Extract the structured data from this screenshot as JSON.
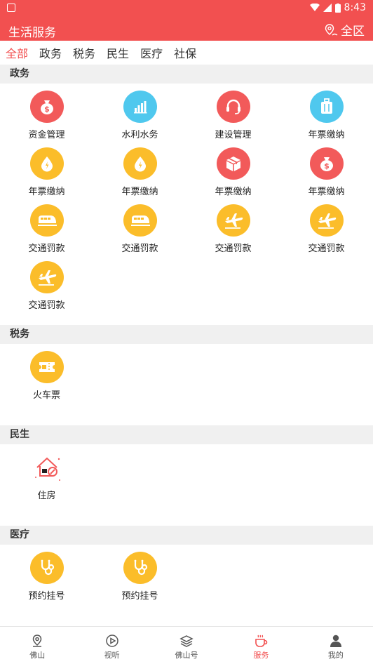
{
  "status": {
    "time": "8:43"
  },
  "header": {
    "title": "生活服务",
    "location": "全区"
  },
  "tabs": [
    {
      "label": "全部",
      "active": true
    },
    {
      "label": "政务"
    },
    {
      "label": "税务"
    },
    {
      "label": "民生"
    },
    {
      "label": "医疗"
    },
    {
      "label": "社保"
    }
  ],
  "sections": [
    {
      "title": "政务",
      "items": [
        {
          "label": "资金管理",
          "icon": "money-bag-icon",
          "color": "#f25a5a"
        },
        {
          "label": "水利水务",
          "icon": "bar-chart-icon",
          "color": "#4fc8ee"
        },
        {
          "label": "建设管理",
          "icon": "headset-icon",
          "color": "#f25a5a"
        },
        {
          "label": "年票缴纳",
          "icon": "luggage-icon",
          "color": "#4fc8ee"
        },
        {
          "label": "年票缴纳",
          "icon": "water-drop-icon",
          "color": "#fbbd2a"
        },
        {
          "label": "年票缴纳",
          "icon": "water-drop-icon",
          "color": "#fbbd2a"
        },
        {
          "label": "年票缴纳",
          "icon": "box-icon",
          "color": "#f25a5a"
        },
        {
          "label": "年票缴纳",
          "icon": "money-bag-icon",
          "color": "#f25a5a"
        },
        {
          "label": "交通罚款",
          "icon": "train-icon",
          "color": "#fbbd2a"
        },
        {
          "label": "交通罚款",
          "icon": "train-icon",
          "color": "#fbbd2a"
        },
        {
          "label": "交通罚款",
          "icon": "airplane-icon",
          "color": "#fbbd2a"
        },
        {
          "label": "交通罚款",
          "icon": "airplane-icon",
          "color": "#fbbd2a"
        },
        {
          "label": "交通罚款",
          "icon": "airplane-icon",
          "color": "#fbbd2a"
        }
      ]
    },
    {
      "title": "税务",
      "items": [
        {
          "label": "火车票",
          "icon": "ticket-icon",
          "color": "#fbbd2a"
        }
      ]
    },
    {
      "title": "民生",
      "items": [
        {
          "label": "住房",
          "icon": "house-icon",
          "color": "#ffffff"
        }
      ]
    },
    {
      "title": "医疗",
      "items": [
        {
          "label": "预约挂号",
          "icon": "stethoscope-icon",
          "color": "#fbbd2a"
        },
        {
          "label": "预约挂号",
          "icon": "stethoscope-icon",
          "color": "#fbbd2a"
        }
      ]
    }
  ],
  "bottom_nav": [
    {
      "label": "佛山",
      "icon": "location-pin-icon"
    },
    {
      "label": "视听",
      "icon": "play-circle-icon"
    },
    {
      "label": "佛山号",
      "icon": "layers-icon"
    },
    {
      "label": "服务",
      "icon": "coffee-cup-icon",
      "active": true
    },
    {
      "label": "我的",
      "icon": "person-icon"
    }
  ],
  "accent_color": "#f25050"
}
